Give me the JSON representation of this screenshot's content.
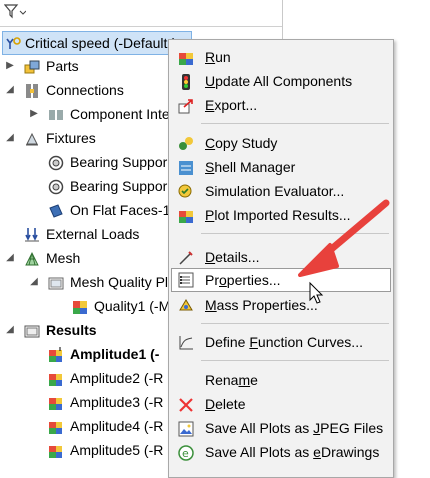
{
  "tree": {
    "filter_icon": "filter-icon",
    "root": "Critical speed (-Default-)",
    "items": [
      {
        "label": "Parts"
      },
      {
        "label": "Connections"
      },
      {
        "label": "Component Inte"
      },
      {
        "label": "Fixtures"
      },
      {
        "label": "Bearing Suppor"
      },
      {
        "label": "Bearing Suppor"
      },
      {
        "label": "On Flat Faces-1"
      },
      {
        "label": "External Loads"
      },
      {
        "label": "Mesh"
      },
      {
        "label": "Mesh Quality Pl"
      },
      {
        "label": "Quality1 (-M"
      },
      {
        "label": "Results"
      },
      {
        "label": "Amplitude1 (-"
      },
      {
        "label": "Amplitude2 (-R"
      },
      {
        "label": "Amplitude3 (-R"
      },
      {
        "label": "Amplitude4 (-R"
      },
      {
        "label": "Amplitude5 (-R"
      }
    ]
  },
  "menu": {
    "items": [
      {
        "pre": "",
        "acc": "R",
        "post": "un"
      },
      {
        "pre": "",
        "acc": "U",
        "post": "pdate All Components"
      },
      {
        "pre": "",
        "acc": "E",
        "post": "xport..."
      },
      {
        "pre": "",
        "acc": "C",
        "post": "opy Study"
      },
      {
        "pre": "",
        "acc": "S",
        "post": "hell Manager"
      },
      {
        "pre": "Simulation Evaluator",
        "acc": "",
        "post": "..."
      },
      {
        "pre": "",
        "acc": "P",
        "post": "lot Imported Results..."
      },
      {
        "pre": "",
        "acc": "D",
        "post": "etails..."
      },
      {
        "pre": "Pr",
        "acc": "o",
        "post": "perties..."
      },
      {
        "pre": "",
        "acc": "M",
        "post": "ass Properties..."
      },
      {
        "pre": "Define ",
        "acc": "F",
        "post": "unction Curves..."
      },
      {
        "pre": "Rena",
        "acc": "m",
        "post": "e"
      },
      {
        "pre": "",
        "acc": "D",
        "post": "elete"
      },
      {
        "pre": "Save All Plots as ",
        "acc": "J",
        "post": "PEG Files"
      },
      {
        "pre": "Save All Plots as ",
        "acc": "e",
        "post": "Drawings"
      }
    ]
  },
  "colors": {
    "arrow": "#e8413c",
    "selection": "#cfe3f7",
    "menu_bg": "#f2f2f2"
  }
}
